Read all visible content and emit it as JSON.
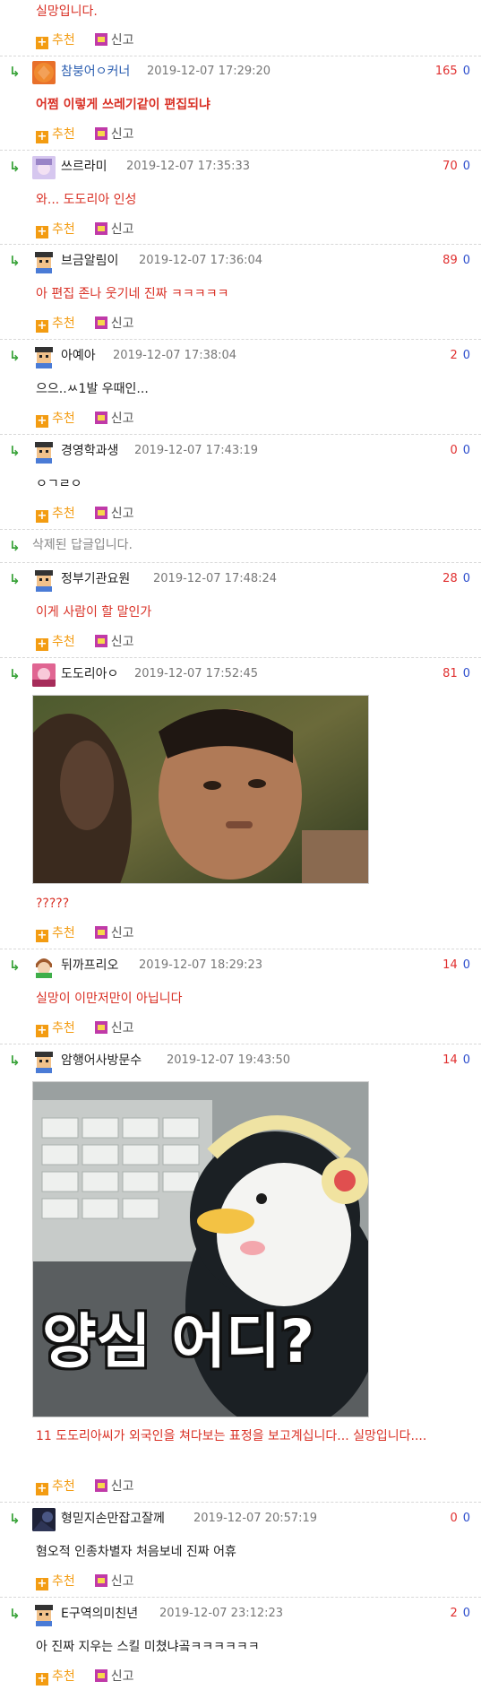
{
  "actions": {
    "recommend": "추천",
    "report": "신고"
  },
  "deleted_text": "삭제된 답글입니다.",
  "comments": [
    {
      "content": "실망입니다."
    },
    {
      "nick": "참붕어ㅇ커너",
      "date": "2019-12-07 17:29:20",
      "up": "165",
      "down": "0",
      "content": "어쩜 이렇게 쓰레기같이 편집되냐"
    },
    {
      "nick": "쓰르라미",
      "date": "2019-12-07 17:35:33",
      "up": "70",
      "down": "0",
      "content": "와... 도도리아 인성"
    },
    {
      "nick": "브금알림이",
      "date": "2019-12-07 17:36:04",
      "up": "89",
      "down": "0",
      "content": "아 편집 존나 웃기네 진짜 ㅋㅋㅋㅋㅋ"
    },
    {
      "nick": "아예아",
      "date": "2019-12-07 17:38:04",
      "up": "2",
      "down": "0",
      "content": "으으..ㅆ1발 우때인..."
    },
    {
      "nick": "경영학과생",
      "date": "2019-12-07 17:43:19",
      "up": "0",
      "down": "0",
      "content": "ㅇㄱㄹㅇ"
    },
    {
      "nick": "정부기관요원",
      "date": "2019-12-07 17:48:24",
      "up": "28",
      "down": "0",
      "content": "이게 사람이 할 말인가"
    },
    {
      "nick": "도도리아ㅇ",
      "date": "2019-12-07 17:52:45",
      "up": "81",
      "down": "0",
      "content": "?????"
    },
    {
      "nick": "뒤까프리오",
      "date": "2019-12-07 18:29:23",
      "up": "14",
      "down": "0",
      "content": "실망이 이만저만이 아닙니다"
    },
    {
      "nick": "암행어사방문수",
      "date": "2019-12-07 19:43:50",
      "up": "14",
      "down": "0",
      "image_caption": "양심 어디?",
      "content": "11 도도리아씨가 외국인을 쳐다보는 표정을 보고계십니다... 실망입니다...."
    },
    {
      "nick": "형믿지손만잡고잘께",
      "date": "2019-12-07 20:57:19",
      "up": "0",
      "down": "0",
      "content": "혐오적 인종차별자 처음보네 진짜 어휴"
    },
    {
      "nick": "E구역의미친년",
      "date": "2019-12-07 23:12:23",
      "up": "2",
      "down": "0",
      "content": "아 진짜 지우는 스킬 미쳤냐곸ㅋㅋㅋㅋㅋㅋ"
    }
  ],
  "colors": {
    "recommend": "#f39c12",
    "report": "#c03aa8",
    "upvote": "#e03030",
    "downvote": "#2b4ccc",
    "reply_arrow": "#3aa33a",
    "red_text": "#d93025"
  }
}
